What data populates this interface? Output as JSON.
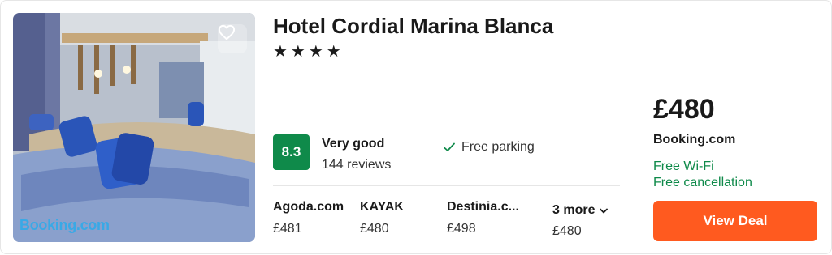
{
  "hotel": {
    "name": "Hotel Cordial Marina Blanca",
    "stars": "★★★★",
    "photo_watermark": "Booking.com"
  },
  "rating": {
    "score": "8.3",
    "label": "Very good",
    "reviews": "144 reviews"
  },
  "amenities": [
    {
      "icon": "check-icon",
      "label": "Free parking"
    }
  ],
  "providers": [
    {
      "name": "Agoda.com",
      "price": "£481"
    },
    {
      "name": "KAYAK",
      "price": "£480"
    },
    {
      "name": "Destinia.c...",
      "price": "£498"
    }
  ],
  "more": {
    "label": "3 more",
    "price": "£480",
    "icon": "chevron-down-icon"
  },
  "deal": {
    "price": "£480",
    "provider": "Booking.com",
    "perks": [
      "Free Wi-Fi",
      "Free cancellation"
    ],
    "button_label": "View Deal"
  },
  "colors": {
    "score_badge": "#0f8a4a",
    "perk_text": "#0f8a4a",
    "deal_button": "#ff5a1f",
    "watermark": "#39a9e6"
  }
}
